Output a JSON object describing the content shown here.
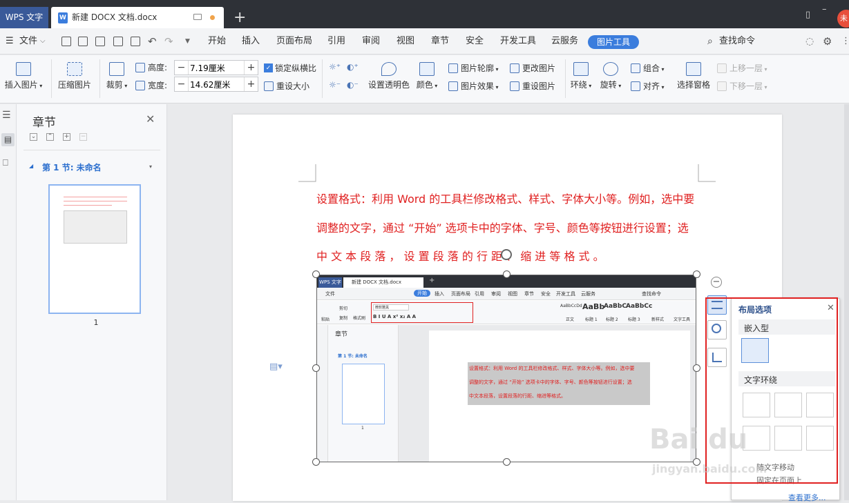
{
  "titlebar": {
    "app_tab": "WPS 文字",
    "doc_tab": "新建 DOCX 文档.docx",
    "new_tab_glyph": "+",
    "user_badge": "未"
  },
  "menubar": {
    "file": "文件",
    "tabs": [
      "开始",
      "插入",
      "页面布局",
      "引用",
      "审阅",
      "视图",
      "章节",
      "安全",
      "开发工具",
      "云服务"
    ],
    "active_tab": "图片工具",
    "search": "查找命令"
  },
  "ribbon": {
    "insert_picture": "插入图片",
    "compress_picture": "压缩图片",
    "crop": "裁剪",
    "height_label": "高度:",
    "height_value": "7.19厘米",
    "width_label": "宽度:",
    "width_value": "14.62厘米",
    "lock_ratio": "锁定纵横比",
    "reset_size": "重设大小",
    "set_transparent": "设置透明色",
    "color": "颜色",
    "picture_outline": "图片轮廓",
    "picture_effect": "图片效果",
    "change_picture": "更改图片",
    "reset_picture": "重设图片",
    "wrap": "环绕",
    "rotate": "旋转",
    "group": "组合",
    "align": "对齐",
    "selection_pane": "选择窗格",
    "bring_forward": "上移一层",
    "send_backward": "下移一层"
  },
  "nav_panel": {
    "title": "章节",
    "section": "第 1 节: 未命名",
    "page_number": "1"
  },
  "document": {
    "line1": "设置格式：利用 Word 的工具栏修改格式、样式、字体大小等。例如，选中要",
    "line2": "调整的文字，通过 “开始” 选项卡中的字体、字号、颜色等按钮进行设置；选",
    "line3": "中 文 本 段 落 ， 设 置 段 落 的 行 距 、 缩 进 等 格 式 。"
  },
  "embedded_screenshot": {
    "app_tab": "WPS 文字",
    "doc_tab": "新建 DOCX 文档.docx",
    "file": "文件",
    "tabs": [
      "开始",
      "插入",
      "页面布局",
      "引用",
      "审阅",
      "视图",
      "章节",
      "安全",
      "开发工具",
      "云服务"
    ],
    "search": "查找命令",
    "paste": "粘贴",
    "cut": "剪切",
    "copy": "复制",
    "format_painter": "格式刷",
    "font_name": "微软雅黑",
    "style_previews": [
      "AaBbCcDd",
      "AaBb",
      "AaBbC",
      "AaBbCc"
    ],
    "style_names": [
      "正文",
      "标题 1",
      "标题 2",
      "标题 3"
    ],
    "new_style": "新样式",
    "text_tools": "文字工具",
    "panel_title": "章节",
    "section": "第 1 节: 未命名",
    "page_number": "1",
    "line1": "设置格式：利用 Word 的工具栏修改格式、样式、字体大小等。例如，选中要",
    "line2": "调整的文字，通过 “开始” 选项卡中的字体、字号、颜色等按钮进行设置；选",
    "line3": "中文本段落，设置段落的行距、缩进等格式。"
  },
  "layout_popup": {
    "title": "布局选项",
    "inline_label": "嵌入型",
    "wrap_label": "文字环绕",
    "move_with_text": "随文字移动",
    "fix_on_page": "固定在页面上",
    "see_more": "查看更多..."
  },
  "watermark": {
    "brand": "Bai du",
    "url": "jingyan.baidu.com"
  },
  "colors": {
    "accent": "#3b7ddd",
    "titlebar": "#2e3137",
    "doc_text_red": "#e02020",
    "highlight_box": "#e02020"
  }
}
